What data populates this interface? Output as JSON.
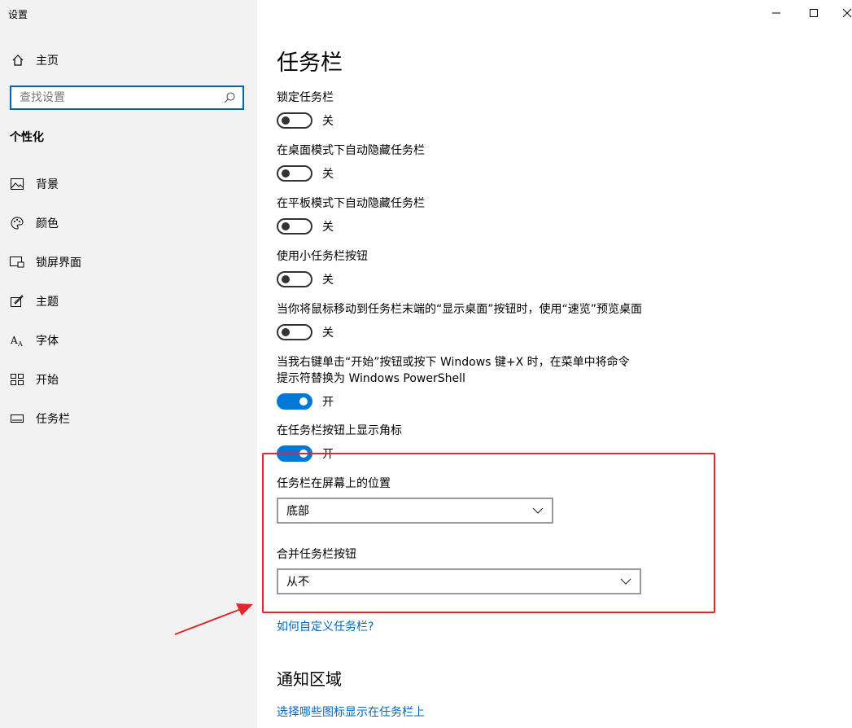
{
  "window": {
    "title": "设置"
  },
  "sidebar": {
    "home_label": "主页",
    "search_placeholder": "查找设置",
    "section": "个性化",
    "items": [
      {
        "label": "背景",
        "icon": "picture-icon"
      },
      {
        "label": "颜色",
        "icon": "palette-icon"
      },
      {
        "label": "锁屏界面",
        "icon": "lock-screen-icon"
      },
      {
        "label": "主题",
        "icon": "theme-icon"
      },
      {
        "label": "字体",
        "icon": "font-icon"
      },
      {
        "label": "开始",
        "icon": "start-icon"
      },
      {
        "label": "任务栏",
        "icon": "taskbar-icon"
      }
    ]
  },
  "main": {
    "title": "任务栏",
    "toggles": [
      {
        "label": "锁定任务栏",
        "state": "关",
        "on": false
      },
      {
        "label": "在桌面模式下自动隐藏任务栏",
        "state": "关",
        "on": false
      },
      {
        "label": "在平板模式下自动隐藏任务栏",
        "state": "关",
        "on": false
      },
      {
        "label": "使用小任务栏按钮",
        "state": "关",
        "on": false
      },
      {
        "label": "当你将鼠标移动到任务栏末端的“显示桌面”按钮时，使用“速览”预览桌面",
        "state": "关",
        "on": false
      },
      {
        "label": "当我右键单击“开始”按钮或按下 Windows 键+X 时，在菜单中将命令提示符替换为 Windows PowerShell",
        "state": "开",
        "on": true
      },
      {
        "label": "在任务栏按钮上显示角标",
        "state": "开",
        "on": true
      }
    ],
    "position_label": "任务栏在屏幕上的位置",
    "position_value": "底部",
    "combine_label": "合并任务栏按钮",
    "combine_value": "从不",
    "help_link": "如何自定义任务栏?",
    "notify_title": "通知区域",
    "notify_link": "选择哪些图标显示在任务栏上"
  },
  "colors": {
    "accent": "#0078d7",
    "link": "#0067c0",
    "annotation": "#e3262b",
    "sidebar_bg": "#f2f2f2"
  }
}
